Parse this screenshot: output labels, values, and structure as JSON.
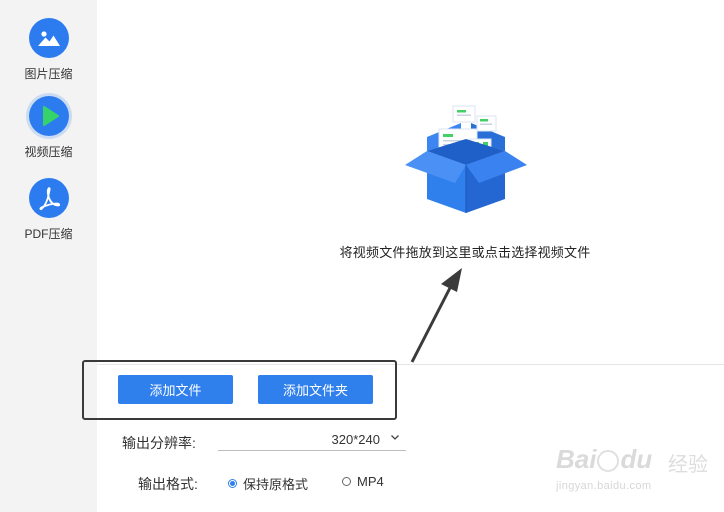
{
  "sidebar": {
    "items": [
      {
        "label": "图片压缩",
        "icon": "image-icon",
        "active": false
      },
      {
        "label": "视频压缩",
        "icon": "play-icon",
        "active": true
      },
      {
        "label": "PDF压缩",
        "icon": "pdf-icon",
        "active": false
      }
    ]
  },
  "dropzone": {
    "icon": "open-box-icon",
    "text": "将视频文件拖放到这里或点击选择视频文件"
  },
  "actions": {
    "add_file_label": "添加文件",
    "add_folder_label": "添加文件夹"
  },
  "output": {
    "resolution_label": "输出分辨率:",
    "resolution_value": "320*240",
    "format_label": "输出格式:",
    "format_options": [
      {
        "label": "保持原格式",
        "checked": true
      },
      {
        "label": "MP4",
        "checked": false
      }
    ]
  },
  "watermark": {
    "brand": "Bai",
    "brand_tail": "du",
    "cn": "经验",
    "url": "jingyan.baidu.com"
  },
  "colors": {
    "accent": "#2f80ed",
    "sidebar_bg": "#f3f3f3",
    "box_blue": "#2c7cf0"
  }
}
